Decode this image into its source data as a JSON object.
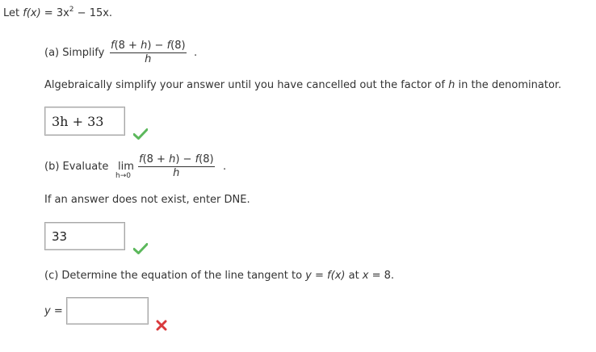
{
  "problem": {
    "intro_prefix": "Let ",
    "intro_fx": "f(x)",
    "intro_eq": " = 3x",
    "intro_exp": "2",
    "intro_suffix": " − 15x."
  },
  "part_a": {
    "label": "(a) Simplify",
    "numerator": "f(8 + h) − f(8)",
    "denominator": "h",
    "period": ".",
    "instruction_prefix": "Algebraically simplify your answer until you have cancelled out the factor of ",
    "instruction_var": "h",
    "instruction_suffix": " in the denominator.",
    "answer_value": "3h + 33",
    "status": "correct"
  },
  "part_b": {
    "label": "(b) Evaluate",
    "lim": "lim",
    "lim_sub": "h→0",
    "numerator": "f(8 + h) − f(8)",
    "denominator": "h",
    "period": ".",
    "instruction": "If an answer does not exist, enter DNE.",
    "answer_value": "33",
    "status": "correct"
  },
  "part_c": {
    "text_prefix": "(c) Determine the equation of the line tangent to ",
    "text_y": "y",
    "text_mid": " = ",
    "text_fx": "f(x)",
    "text_at": " at ",
    "text_x": "x",
    "text_end": " = 8.",
    "answer_label": "y =",
    "answer_value": "",
    "status": "incorrect"
  },
  "colors": {
    "correct": "#5cb85c",
    "incorrect": "#d9393c"
  }
}
